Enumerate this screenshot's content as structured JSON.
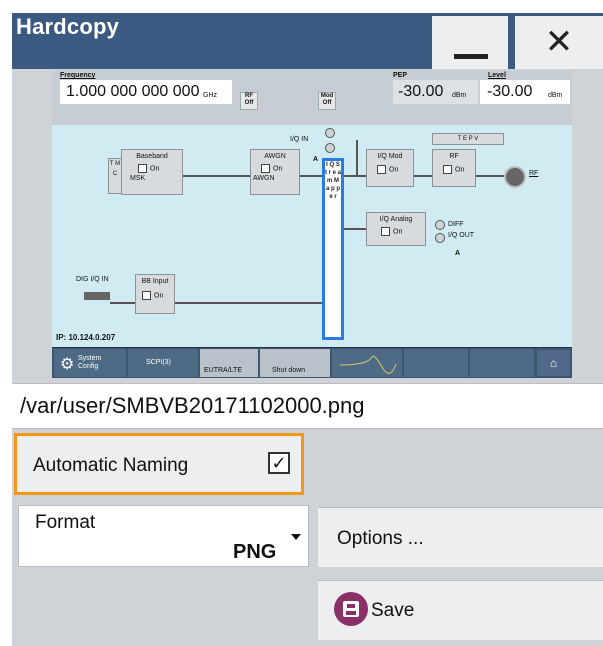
{
  "window": {
    "title": "Hardcopy"
  },
  "preview": {
    "frequency_label": "Frequency",
    "frequency_value": "1.000 000 000 000",
    "frequency_unit": "GHz",
    "rf_off": "RF Off",
    "mod_off": "Mod Off",
    "pep_label": "PEP",
    "pep_value": "-30.00",
    "pep_unit": "dBm",
    "level_label": "Level",
    "level_value": "-30.00",
    "level_unit": "dBm",
    "tmc": "T M C",
    "baseband_title": "Baseband",
    "baseband_on": "On",
    "baseband_sub": "MSK",
    "awgn_title": "AWGN",
    "awgn_on": "On",
    "awgn_sub": "AWGN",
    "iq_in": "I/Q IN",
    "a_marker": "A",
    "iq_mod_title": "I/Q Mod",
    "iq_mod_on": "On",
    "rf_title": "RF",
    "rf_on": "On",
    "tepv": "T E P V",
    "rf_port": "RF",
    "iq_analog_title": "I/Q Analog",
    "iq_analog_on": "On",
    "diff": "DIFF",
    "iq_out": "I/Q OUT",
    "a_out": "A",
    "stream_mapper": "I Q S t r e a m M a p p e r",
    "dig_iq_in": "DIG I/Q IN",
    "bb_input_title": "BB Input",
    "bb_input_on": "On",
    "ip": "IP: 10.124.0.207",
    "tab_system": "System Config",
    "tab_scpi": "SCPI(3)",
    "tab_eutra": "EUTRA/LTE",
    "tab_shutdown": "Shut down"
  },
  "file_path": "/var/user/SMBVB20171102000.png",
  "automatic_naming": {
    "label": "Automatic Naming",
    "checked": true,
    "check_glyph": "✓"
  },
  "format": {
    "label": "Format",
    "value": "PNG"
  },
  "options": {
    "label": "Options ..."
  },
  "save": {
    "label": "Save"
  },
  "colors": {
    "title_bar": "#3b5a82",
    "focus_border": "#f2971b",
    "save_icon": "#8a2f68"
  }
}
